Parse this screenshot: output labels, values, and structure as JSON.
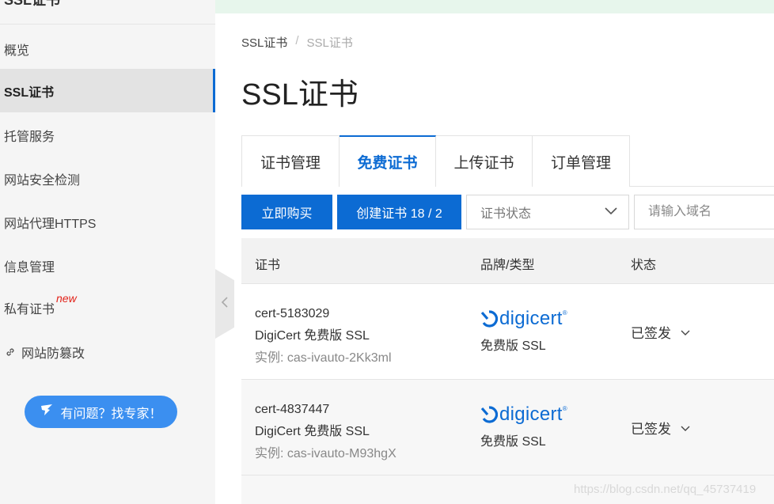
{
  "sidebar": {
    "top_title": "SSL证书",
    "items": [
      {
        "label": "概览"
      },
      {
        "label": "SSL证书"
      },
      {
        "label": "托管服务"
      },
      {
        "label": "网站安全检测"
      },
      {
        "label": "网站代理HTTPS"
      },
      {
        "label": "信息管理"
      },
      {
        "label": "私有证书",
        "badge": "new"
      },
      {
        "label": "网站防篡改"
      }
    ],
    "help_button": "有问题？找专家！"
  },
  "breadcrumb": {
    "root": "SSL证书",
    "sep": "/",
    "current": "SSL证书"
  },
  "page_title": "SSL证书",
  "tabs": [
    {
      "label": "证书管理"
    },
    {
      "label": "免费证书"
    },
    {
      "label": "上传证书"
    },
    {
      "label": "订单管理"
    }
  ],
  "toolbar": {
    "buy_now": "立即购买",
    "create_cert": "创建证书 18 / 2",
    "status_select": "证书状态",
    "domain_placeholder": "请输入域名"
  },
  "table": {
    "headers": {
      "cert": "证书",
      "brand": "品牌/类型",
      "status": "状态"
    },
    "rows": [
      {
        "id": "cert-5183029",
        "name": "DigiCert 免费版 SSL",
        "instance": "实例: cas-ivauto-2Kk3ml",
        "brand": "digicert",
        "brand_mark": "®",
        "type": "免费版 SSL",
        "status": "已签发"
      },
      {
        "id": "cert-4837447",
        "name": "DigiCert 免费版 SSL",
        "instance": "实例: cas-ivauto-M93hgX",
        "brand": "digicert",
        "brand_mark": "®",
        "type": "免费版 SSL",
        "status": "已签发"
      }
    ]
  },
  "watermark": "https://blog.csdn.net/qq_45737419",
  "colors": {
    "accent": "#0c6bd3",
    "help_button": "#3b8ff0",
    "banner": "#e7f6ec"
  }
}
